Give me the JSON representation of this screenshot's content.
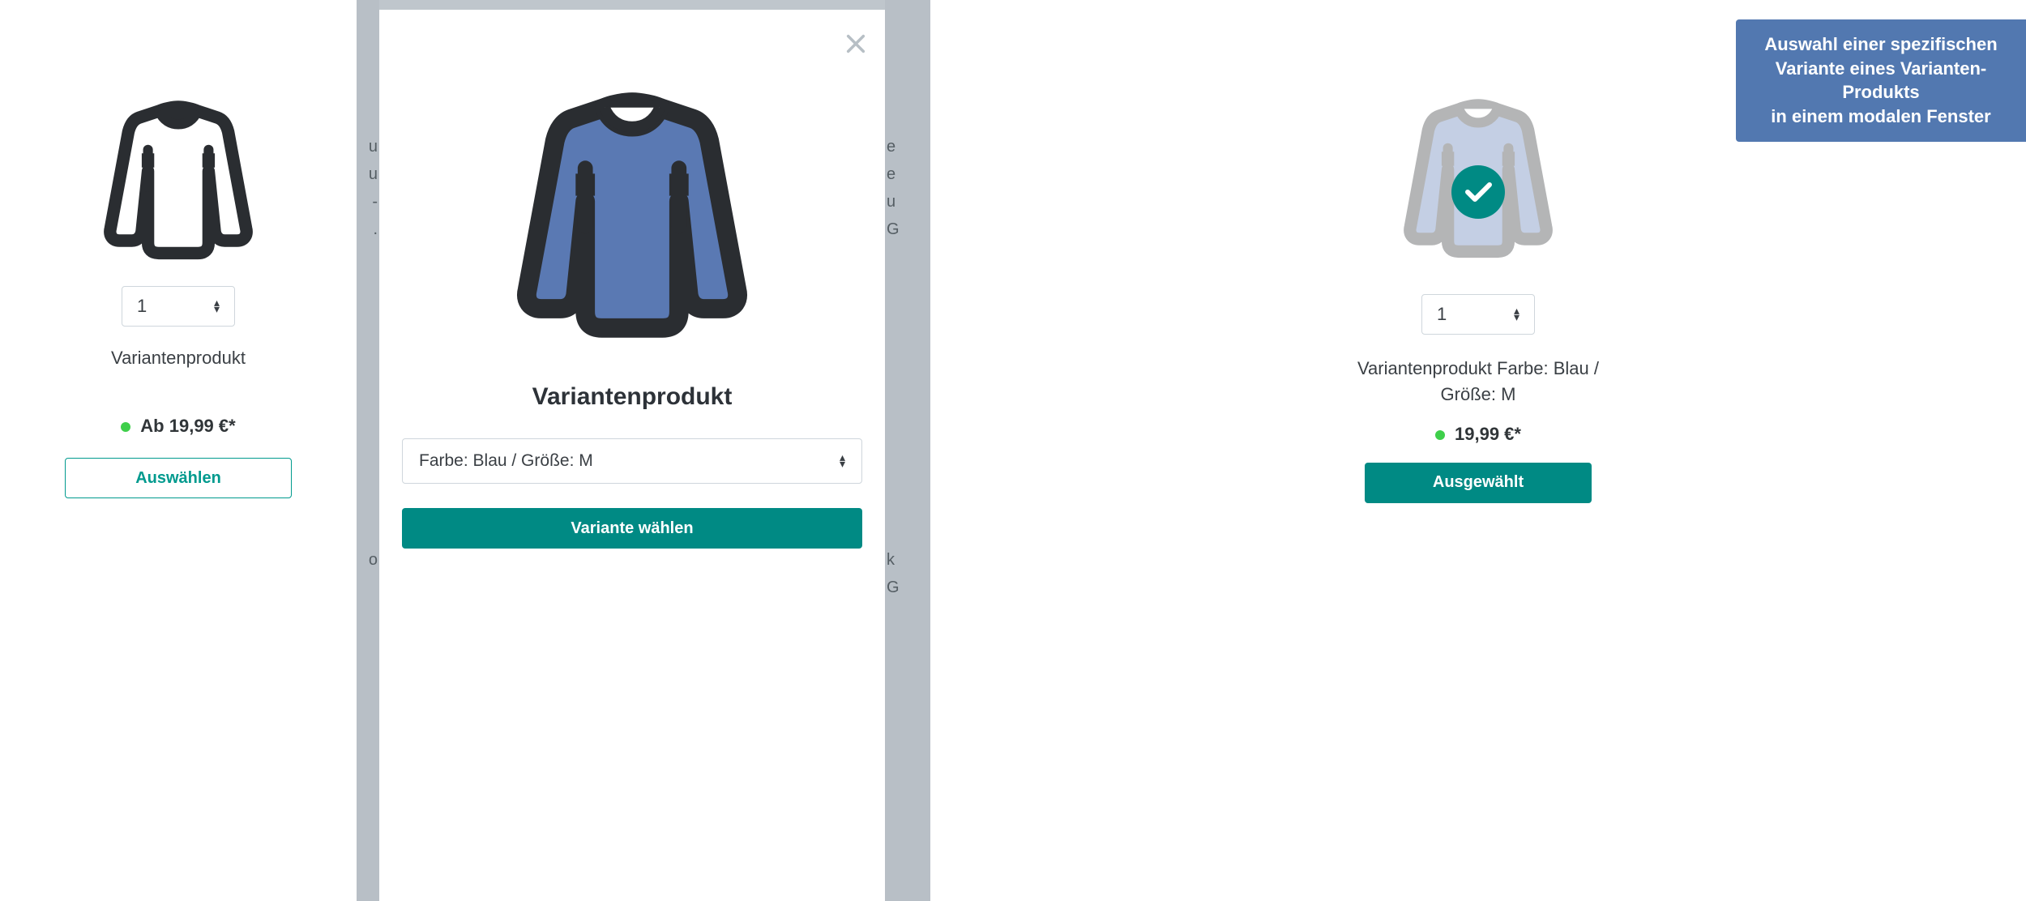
{
  "left": {
    "qty": "1",
    "name": "Variantenprodukt",
    "price": "Ab 19,99 €*",
    "select_label": "Auswählen"
  },
  "modal": {
    "title": "Variantenprodukt",
    "variant_selected": "Farbe: Blau / Größe: M",
    "choose_label": "Variante wählen",
    "bg_left_lines": "u\nu\n-\n.\n\n\n\n\n\n\n\n\n\n\n\no",
    "bg_right_lines": "e\ne\nu\nG\n\n\n\n\n\n\n\n\n\n\n\nk\nG"
  },
  "right": {
    "qty": "1",
    "name_line1": "Variantenprodukt Farbe: Blau /",
    "name_line2": "Größe: M",
    "price": "19,99 €*",
    "selected_label": "Ausgewählt"
  },
  "callout": {
    "line1": "Auswahl einer spezifischen",
    "line2": "Variante eines Varianten-Produkts",
    "line3": "in einem modalen Fenster"
  },
  "colors": {
    "accent": "#008a84",
    "shirt_blue": "#5a79b3",
    "shirt_outline": "#2a2d31"
  }
}
